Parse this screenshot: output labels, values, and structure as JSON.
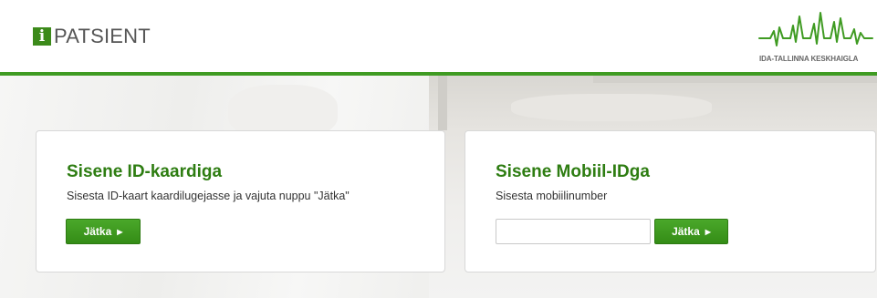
{
  "header": {
    "brand_icon": "i",
    "brand_title": "PATSIENT",
    "hospital_name": "IDA-TALLINNA KESKHAIGLA"
  },
  "colors": {
    "accent_green": "#3f9b22",
    "heading_green": "#2e7d12",
    "button_green": "#3b961d"
  },
  "id_card": {
    "title": "Sisene ID-kaardiga",
    "instruction": "Sisesta ID-kaart kaardilugejasse ja vajuta nuppu \"Jätka\"",
    "button_label": "Jätka",
    "button_icon": "play-arrow-icon"
  },
  "mobile_id": {
    "title": "Sisene Mobiil-IDga",
    "instruction": "Sisesta mobiilinumber",
    "input_value": "",
    "button_label": "Jätka",
    "button_icon": "play-arrow-icon"
  }
}
